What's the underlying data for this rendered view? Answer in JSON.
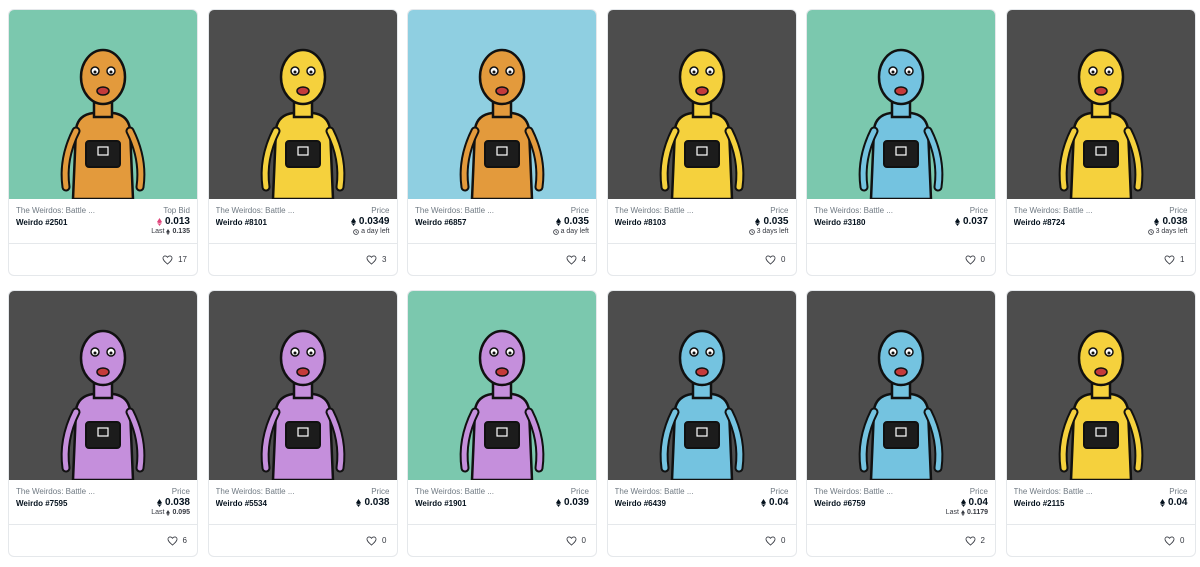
{
  "cards": [
    {
      "collection": "The Weirdos: Battle ...",
      "name": "Weirdo #2501",
      "price_label": "Top Bid",
      "price": "0.013",
      "price_currency_color": "#e0457b",
      "sub_type": "last",
      "sub_label": "Last",
      "sub_value": "0.135",
      "favorites": "17",
      "bg": "#7bc8ae",
      "skin": "#e39a3c"
    },
    {
      "collection": "The Weirdos: Battle ...",
      "name": "Weirdo #8101",
      "price_label": "Price",
      "price": "0.0349",
      "price_currency_color": "#04111d",
      "sub_type": "time",
      "sub_label": "a day left",
      "sub_value": "",
      "favorites": "3",
      "bg": "#4d4d4d",
      "skin": "#f5d13d"
    },
    {
      "collection": "The Weirdos: Battle ...",
      "name": "Weirdo #6857",
      "price_label": "Price",
      "price": "0.035",
      "price_currency_color": "#04111d",
      "sub_type": "time",
      "sub_label": "a day left",
      "sub_value": "",
      "favorites": "4",
      "bg": "#8fcfe1",
      "skin": "#e39a3c"
    },
    {
      "collection": "The Weirdos: Battle ...",
      "name": "Weirdo #8103",
      "price_label": "Price",
      "price": "0.035",
      "price_currency_color": "#04111d",
      "sub_type": "time",
      "sub_label": "3 days left",
      "sub_value": "",
      "favorites": "0",
      "bg": "#4d4d4d",
      "skin": "#f5d13d"
    },
    {
      "collection": "The Weirdos: Battle ...",
      "name": "Weirdo #3180",
      "price_label": "Price",
      "price": "0.037",
      "price_currency_color": "#04111d",
      "sub_type": "none",
      "sub_label": "",
      "sub_value": "",
      "favorites": "0",
      "bg": "#7bc8ae",
      "skin": "#74c3e0"
    },
    {
      "collection": "The Weirdos: Battle ...",
      "name": "Weirdo #8724",
      "price_label": "Price",
      "price": "0.038",
      "price_currency_color": "#04111d",
      "sub_type": "time",
      "sub_label": "3 days left",
      "sub_value": "",
      "favorites": "1",
      "bg": "#4d4d4d",
      "skin": "#f5d13d"
    },
    {
      "collection": "The Weirdos: Battle ...",
      "name": "Weirdo #7595",
      "price_label": "Price",
      "price": "0.038",
      "price_currency_color": "#04111d",
      "sub_type": "last",
      "sub_label": "Last",
      "sub_value": "0.095",
      "favorites": "6",
      "bg": "#4d4d4d",
      "skin": "#c58fdc"
    },
    {
      "collection": "The Weirdos: Battle ...",
      "name": "Weirdo #5534",
      "price_label": "Price",
      "price": "0.038",
      "price_currency_color": "#04111d",
      "sub_type": "none",
      "sub_label": "",
      "sub_value": "",
      "favorites": "0",
      "bg": "#4d4d4d",
      "skin": "#c58fdc"
    },
    {
      "collection": "The Weirdos: Battle ...",
      "name": "Weirdo #1901",
      "price_label": "Price",
      "price": "0.039",
      "price_currency_color": "#04111d",
      "sub_type": "none",
      "sub_label": "",
      "sub_value": "",
      "favorites": "0",
      "bg": "#7bc8ae",
      "skin": "#c58fdc"
    },
    {
      "collection": "The Weirdos: Battle ...",
      "name": "Weirdo #6439",
      "price_label": "Price",
      "price": "0.04",
      "price_currency_color": "#04111d",
      "sub_type": "none",
      "sub_label": "",
      "sub_value": "",
      "favorites": "0",
      "bg": "#4d4d4d",
      "skin": "#74c3e0"
    },
    {
      "collection": "The Weirdos: Battle ...",
      "name": "Weirdo #6759",
      "price_label": "Price",
      "price": "0.04",
      "price_currency_color": "#04111d",
      "sub_type": "last",
      "sub_label": "Last",
      "sub_value": "0.1179",
      "favorites": "2",
      "bg": "#4d4d4d",
      "skin": "#74c3e0"
    },
    {
      "collection": "The Weirdos: Battle ...",
      "name": "Weirdo #2115",
      "price_label": "Price",
      "price": "0.04",
      "price_currency_color": "#04111d",
      "sub_type": "none",
      "sub_label": "",
      "sub_value": "",
      "favorites": "0",
      "bg": "#4d4d4d",
      "skin": "#f5d13d"
    }
  ],
  "icons": {
    "currency": "eth-icon",
    "favorite": "heart-icon",
    "timer": "clock-icon"
  }
}
